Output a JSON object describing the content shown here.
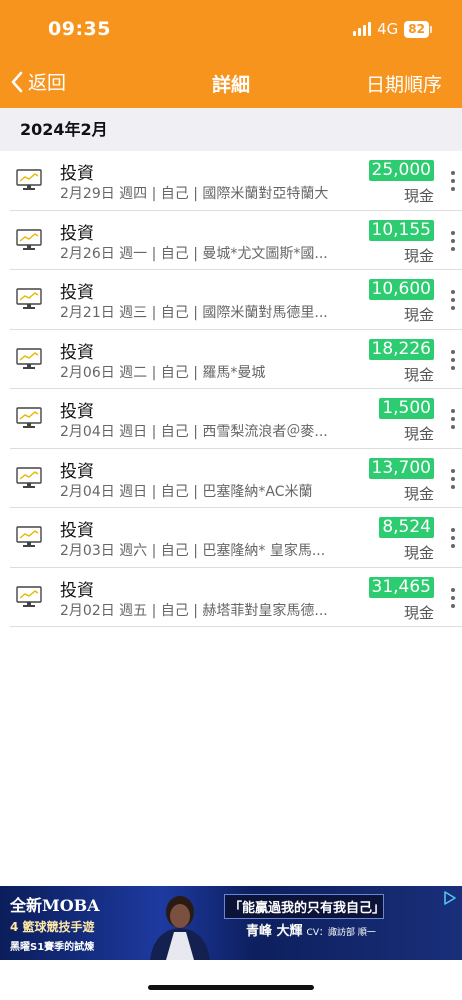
{
  "status_bar": {
    "time": "09:35",
    "network": "4G",
    "battery": "82"
  },
  "nav": {
    "back_label": "返回",
    "title": "詳細",
    "sort_label": "日期順序"
  },
  "section": {
    "title": "2024年2月"
  },
  "rows": [
    {
      "title": "投資",
      "subtitle": "2月29日 週四 | 自己 | 國際米蘭對亞特蘭大",
      "amount": "25,000",
      "method": "現金"
    },
    {
      "title": "投資",
      "subtitle": "2月26日 週一 | 自己 | 曼城*尤文圖斯*國...",
      "amount": "10,155",
      "method": "現金"
    },
    {
      "title": "投資",
      "subtitle": "2月21日 週三 | 自己 | 國際米蘭對馬德里...",
      "amount": "10,600",
      "method": "現金"
    },
    {
      "title": "投資",
      "subtitle": "2月06日 週二 | 自己 | 羅馬*曼城",
      "amount": "18,226",
      "method": "現金"
    },
    {
      "title": "投資",
      "subtitle": "2月04日 週日 | 自己 | 西雪梨流浪者＠麥...",
      "amount": "1,500",
      "method": "現金"
    },
    {
      "title": "投資",
      "subtitle": "2月04日 週日 | 自己 | 巴塞隆納*AC米蘭",
      "amount": "13,700",
      "method": "現金"
    },
    {
      "title": "投資",
      "subtitle": "2月03日 週六 | 自己 | 巴塞隆納* 皇家馬...",
      "amount": "8,524",
      "method": "現金"
    },
    {
      "title": "投資",
      "subtitle": "2月02日 週五 | 自己 | 赫塔菲對皇家馬德...",
      "amount": "31,465",
      "method": "現金"
    }
  ],
  "ad": {
    "title": "全新MOBA",
    "line2": "4 籃球競技手遊",
    "line3": "黑曜S1賽季的試煉",
    "quote": "「能贏過我的只有我自己」",
    "name": "青峰 大輝",
    "cv": "CV：諏訪部 順一"
  },
  "colors": {
    "header": "#f7941d",
    "amount_badge": "#2ecc71"
  }
}
